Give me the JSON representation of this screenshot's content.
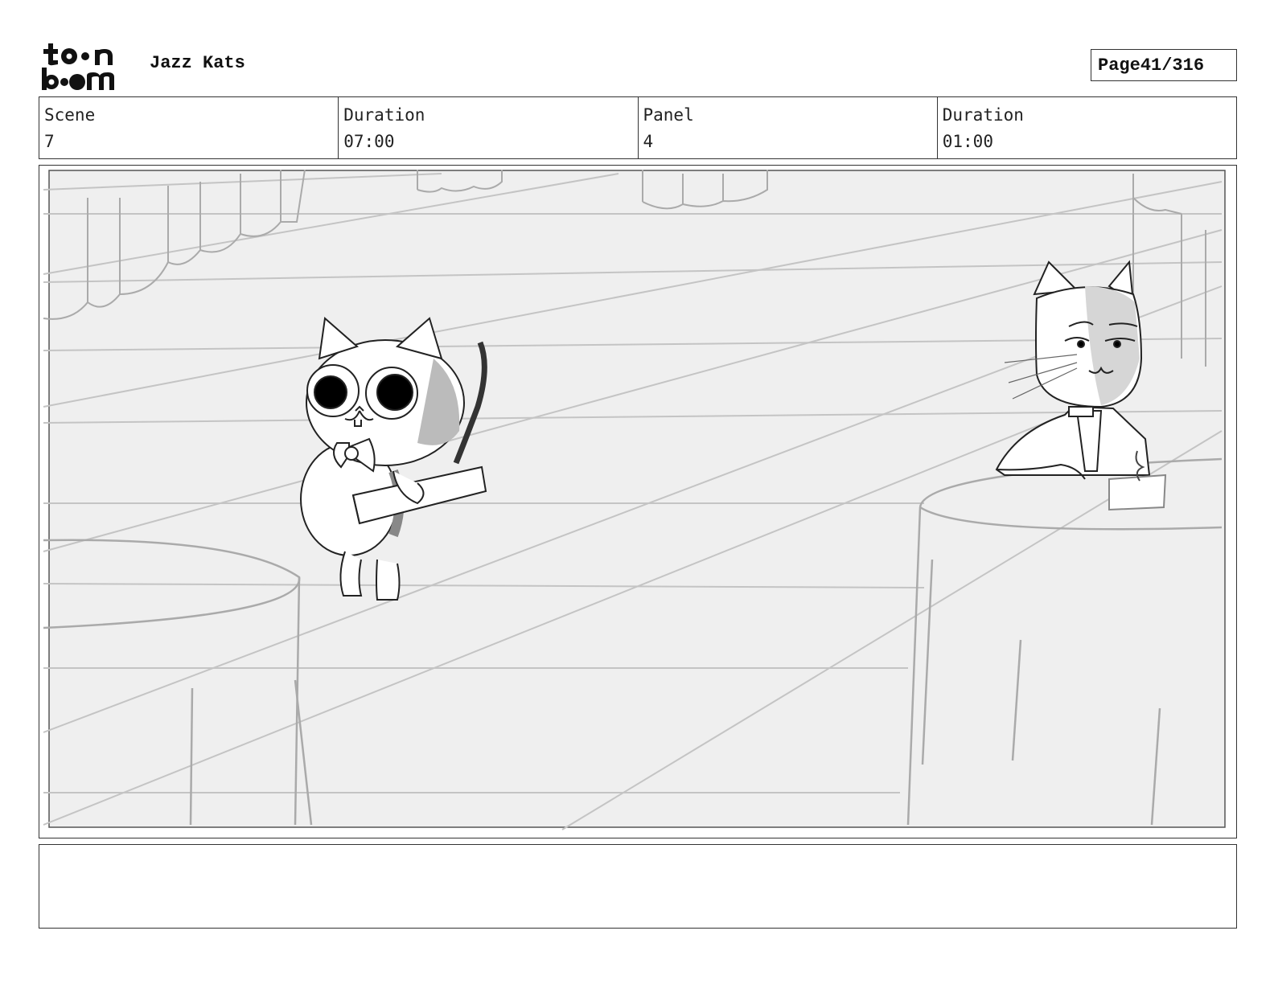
{
  "header": {
    "logo_line1": "toon",
    "logo_line2": "boom",
    "project_title": "Jazz Kats",
    "page_label": "Page",
    "page_value": "41/316"
  },
  "info": {
    "scene_label": "Scene",
    "scene_value": "7",
    "scene_duration_label": "Duration",
    "scene_duration_value": "07:00",
    "panel_label": "Panel",
    "panel_value": "4",
    "panel_duration_label": "Duration",
    "panel_duration_value": "01:00"
  },
  "notes": {
    "text": ""
  },
  "colors": {
    "sketch_bg": "#efefef",
    "sketch_line": "#bdbdbd",
    "ink": "#222222"
  },
  "icons": {
    "logo": "toon-boom-logo"
  }
}
